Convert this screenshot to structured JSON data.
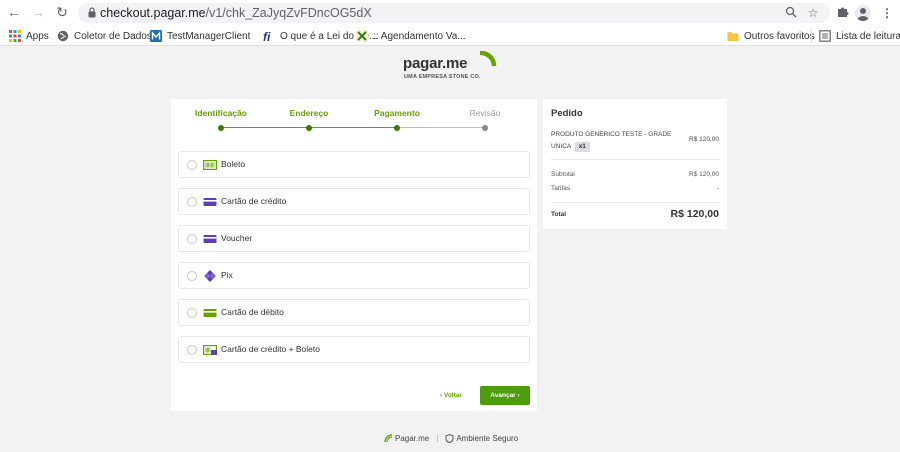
{
  "browser": {
    "url_host": "checkout.pagar.me",
    "url_path": "/v1/chk_ZaJyqZvFDncOG5dX",
    "bookmarks": [
      {
        "label": "Apps",
        "icon": "apps-grid-icon"
      },
      {
        "label": "Coletor de Dados",
        "icon": "globe-icon"
      },
      {
        "label": "TestManagerClient",
        "icon": "testmanager-icon"
      },
      {
        "label": "O que é a Lei do Be...",
        "icon": "fi-icon"
      },
      {
        "label": ":: Agendamento Va...",
        "icon": "agendamento-icon"
      }
    ],
    "bookmarks_right": [
      {
        "label": "Outros favoritos",
        "icon": "folder-icon"
      },
      {
        "label": "Lista de leitura",
        "icon": "reading-list-icon"
      }
    ]
  },
  "brand": {
    "name_main": "pagar",
    "name_suffix": ".me",
    "tagline": "UMA EMPRESA STONE CO.",
    "accent_color": "#65a300"
  },
  "steps": [
    {
      "label": "Identificação",
      "state": "done"
    },
    {
      "label": "Endereço",
      "state": "done"
    },
    {
      "label": "Pagamento",
      "state": "active"
    },
    {
      "label": "Revisão",
      "state": "pending"
    }
  ],
  "payment_options": [
    {
      "label": "Boleto",
      "icon": "boleto-icon",
      "selected": false
    },
    {
      "label": "Cartão de crédito",
      "icon": "credit-card-icon",
      "selected": false
    },
    {
      "label": "Voucher",
      "icon": "voucher-icon",
      "selected": false
    },
    {
      "label": "Pix",
      "icon": "pix-icon",
      "selected": false
    },
    {
      "label": "Cartão de débito",
      "icon": "debit-card-icon",
      "selected": false
    },
    {
      "label": "Cartão de crédito + Boleto",
      "icon": "credit-boleto-icon",
      "selected": false
    }
  ],
  "actions": {
    "back_label": "‹  Voltar",
    "next_label": "Avançar  ›"
  },
  "order": {
    "title": "Pedido",
    "product_name": "PRODUTO GENERICO TESTE - GRADE UNICA",
    "product_qty": "x1",
    "product_price": "R$ 120,00",
    "subtotal_label": "Subtotal",
    "subtotal_value": "R$ 120,00",
    "fees_label": "Tarifas",
    "fees_value": "-",
    "total_label": "Total",
    "total_value": "R$ 120,00"
  },
  "footer": {
    "brand": "Pagar.me",
    "separator": "|",
    "secure": "Ambiente Seguro"
  }
}
